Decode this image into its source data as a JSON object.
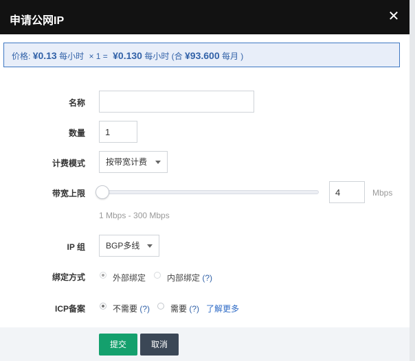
{
  "dialog": {
    "title": "申请公网IP",
    "close_glyph": "✕"
  },
  "price": {
    "label": "价格:",
    "unit_price": "¥0.13",
    "unit_period": "每小时",
    "multiplier": "× 1 =",
    "total": "¥0.130",
    "total_period": "每小时",
    "monthly_open": "(合",
    "monthly": "¥93.600",
    "monthly_period": "每月 )"
  },
  "form": {
    "name": {
      "label": "名称",
      "value": ""
    },
    "count": {
      "label": "数量",
      "value": "1"
    },
    "billing": {
      "label": "计费模式",
      "selected": "按带宽计费"
    },
    "bandwidth": {
      "label": "带宽上限",
      "value": "4",
      "unit": "Mbps",
      "hint": "1 Mbps - 300 Mbps",
      "slider_level": 0.0
    },
    "ip_group": {
      "label": "IP 组",
      "selected": "BGP多线"
    },
    "binding": {
      "label": "绑定方式",
      "options": [
        {
          "text": "外部绑定",
          "checked": true
        },
        {
          "text": "内部绑定",
          "help": "(?)",
          "checked": false
        }
      ]
    },
    "icp": {
      "label": "ICP备案",
      "options": [
        {
          "text": "不需要",
          "help": "(?)",
          "checked": true
        },
        {
          "text": "需要",
          "help": "(?)",
          "checked": false
        }
      ],
      "learn_more": "了解更多"
    }
  },
  "actions": {
    "submit": "提交",
    "cancel": "取消"
  },
  "colors": {
    "titlebar": "#121212",
    "price_bg": "#e8eef9",
    "price_text": "#3262a8",
    "submit": "#14a06d",
    "cancel": "#3b4756"
  }
}
